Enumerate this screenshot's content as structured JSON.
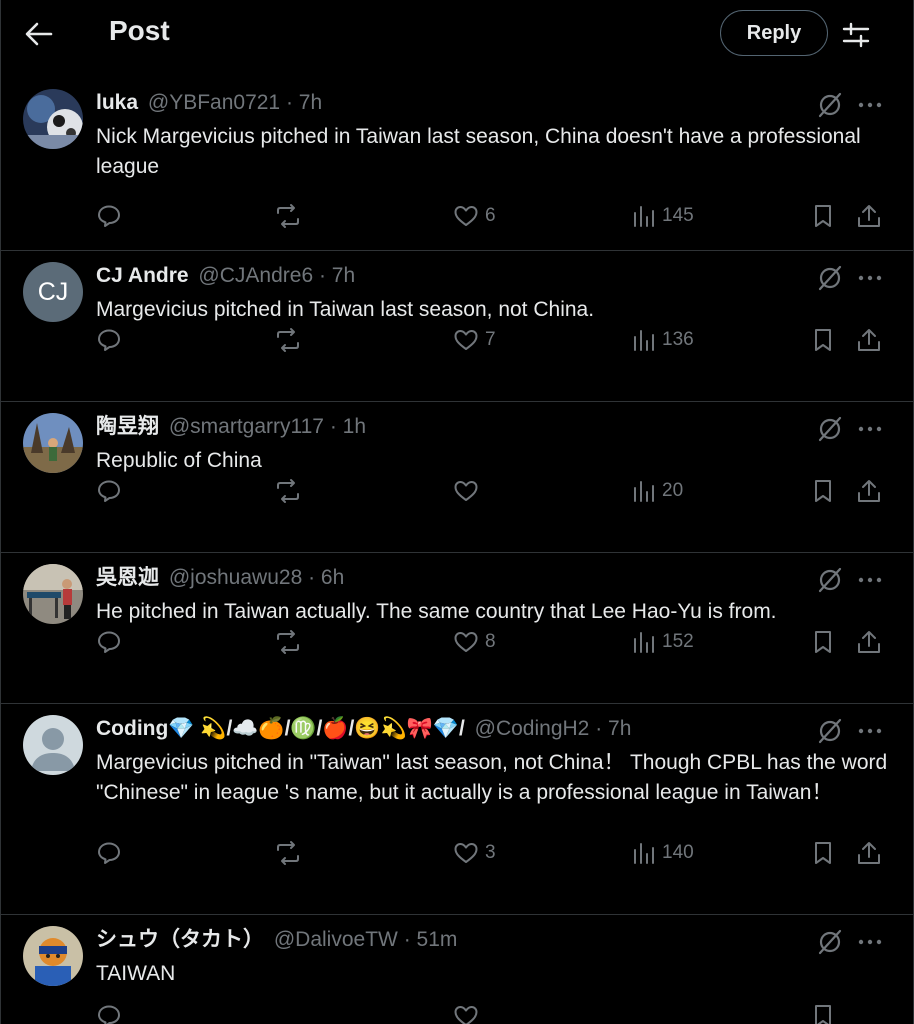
{
  "header": {
    "title": "Post",
    "reply_label": "Reply"
  },
  "replies": [
    {
      "name": "luka",
      "handle": "@YBFan0721",
      "time": "· 7h",
      "text": "Nick Margevicius pitched in Taiwan last season, China doesn't have a professional league",
      "likes": "6",
      "views": "145",
      "avatar_initials": ""
    },
    {
      "name": "CJ Andre",
      "handle": "@CJAndre6",
      "time": "· 7h",
      "text": "Margevicius pitched in Taiwan last season, not China.",
      "likes": "7",
      "views": "136",
      "avatar_initials": "CJ"
    },
    {
      "name": "陶昱翔",
      "handle": "@smartgarry117",
      "time": "· 1h",
      "text": "Republic of China",
      "likes": "",
      "views": "20",
      "avatar_initials": ""
    },
    {
      "name": "吳恩迦",
      "handle": "@joshuawu28",
      "time": "· 6h",
      "text": "He pitched in Taiwan actually. The same country that Lee Hao-Yu is from.",
      "likes": "8",
      "views": "152",
      "avatar_initials": ""
    },
    {
      "name": "Coding💎 💫/☁️🍊/♍/🍎/😆💫🎀💎/",
      "handle": "@CodingH2",
      "time": "· 7h",
      "text": "Margevicius pitched in \"Taiwan\" last season, not China！ Though CPBL has the word \"Chinese\" in league 's name, but it actually is a professional league in Taiwan！",
      "likes": "3",
      "views": "140",
      "avatar_initials": ""
    },
    {
      "name": "シュウ（タカト）",
      "handle": "@DalivoeTW",
      "time": "· 51m",
      "text": "TAIWAN",
      "likes": "",
      "views": "",
      "avatar_initials": ""
    }
  ],
  "colors": {
    "background": "#000000",
    "text": "#e7e9ea",
    "secondary": "#71767b",
    "divider": "#2f3336"
  }
}
